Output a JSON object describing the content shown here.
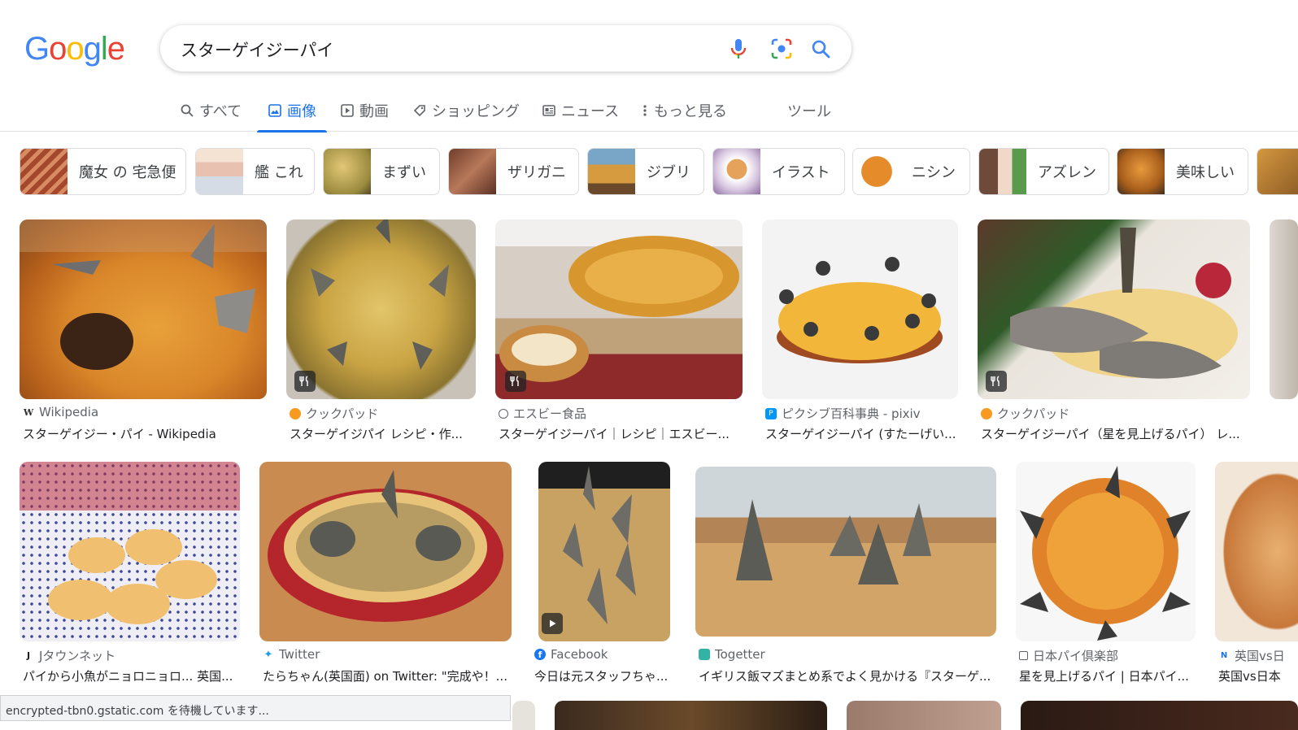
{
  "search": {
    "query": "スターゲイジーパイ"
  },
  "logo": {
    "letters": [
      "G",
      "o",
      "o",
      "g",
      "l",
      "e"
    ],
    "colors": [
      "#4285F4",
      "#EA4335",
      "#FBBC05",
      "#4285F4",
      "#34A853",
      "#EA4335"
    ]
  },
  "tabs": [
    {
      "label": "すべて",
      "icon": "search-icon"
    },
    {
      "label": "画像",
      "icon": "image-icon"
    },
    {
      "label": "動画",
      "icon": "video-icon"
    },
    {
      "label": "ショッピング",
      "icon": "tag-icon"
    },
    {
      "label": "ニュース",
      "icon": "news-icon"
    },
    {
      "label": "もっと見る",
      "icon": "more-vert-icon"
    },
    {
      "label": "ツール"
    }
  ],
  "chips": [
    {
      "label": "魔女 の 宅急便"
    },
    {
      "label": "艦 これ"
    },
    {
      "label": "まずい"
    },
    {
      "label": "ザリガニ"
    },
    {
      "label": "ジブリ"
    },
    {
      "label": "イラスト"
    },
    {
      "label": "ニシン"
    },
    {
      "label": "アズレン"
    },
    {
      "label": "美味しい"
    }
  ],
  "results_row1": [
    {
      "source": "Wikipedia",
      "title": "スターゲイジー・パイ - Wikipedia"
    },
    {
      "source": "クックパッド",
      "title": "スターゲイジパイ レシピ・作..."
    },
    {
      "source": "エスビー食品",
      "title": "スターゲイジーパイ｜レシピ｜エスビー..."
    },
    {
      "source": "ピクシブ百科事典 - pixiv",
      "title": "スターゲイジーパイ (すたーげい..."
    },
    {
      "source": "クックパッド",
      "title": "スターゲイジーパイ（星を見上げるパイ） レ..."
    }
  ],
  "results_row2": [
    {
      "source": "Jタウンネット",
      "title": "パイから小魚がニョロニョロ... 英国..."
    },
    {
      "source": "Twitter",
      "title": "たらちゃん(英国面) on Twitter: \"完成や！..."
    },
    {
      "source": "Facebook",
      "title": "今日は元スタッフちゃ..."
    },
    {
      "source": "Togetter",
      "title": "イギリス飯マズまとめ系でよく見かける『スターゲ..."
    },
    {
      "source": "日本パイ倶楽部",
      "title": "星を見上げるパイ | 日本パイ..."
    },
    {
      "source": "英国vs日",
      "title": "英国vs日本"
    }
  ],
  "status": "encrypted-tbn0.gstatic.com を待機しています..."
}
